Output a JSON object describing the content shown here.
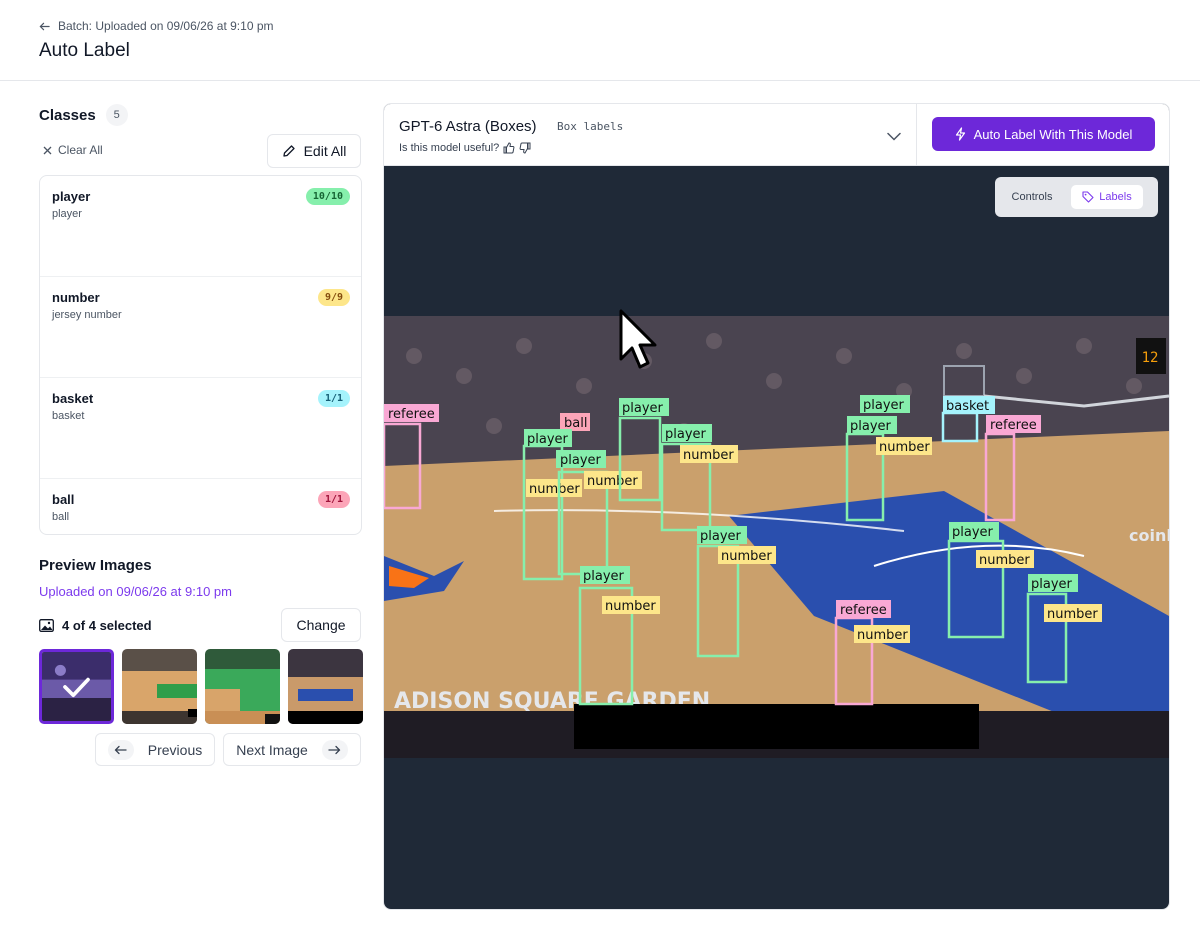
{
  "header": {
    "breadcrumb": "Batch: Uploaded on 09/06/26 at 9:10 pm",
    "title": "Auto Label"
  },
  "classes": {
    "title": "Classes",
    "count": "5",
    "clear_all": "Clear All",
    "edit_all": "Edit All",
    "items": [
      {
        "name": "player",
        "desc": "player",
        "count": "10/10",
        "color": "#86efac"
      },
      {
        "name": "number",
        "desc": "jersey number",
        "count": "9/9",
        "color": "#fde68a"
      },
      {
        "name": "basket",
        "desc": "basket",
        "count": "1/1",
        "color": "#a5f3fc"
      },
      {
        "name": "ball",
        "desc": "ball",
        "count": "1/1",
        "color": "#fca5b8"
      }
    ]
  },
  "preview": {
    "title": "Preview Images",
    "subtitle": "Uploaded on 09/06/26 at 9:10 pm",
    "selected": "4 of 4 selected",
    "change": "Change",
    "previous": "Previous",
    "next": "Next Image"
  },
  "model": {
    "name": "GPT-6 Astra (Boxes)",
    "type": "Box labels",
    "useful_prompt": "Is this model useful?",
    "auto_label_button": "Auto Label With This Model"
  },
  "view_toggle": {
    "controls": "Controls",
    "labels": "Labels"
  },
  "annotations": {
    "player": "player",
    "number": "number",
    "basket": "basket",
    "ball": "ball",
    "referee": "referee",
    "arena_text": "ADISON SQUARE GARDEN",
    "sponsor": "coinb"
  },
  "colors": {
    "accent": "#6d28d9",
    "player": "#86efac",
    "number": "#fde68a",
    "basket": "#a5f3fc",
    "ball": "#fca5b8",
    "referee": "#f9a8d4"
  }
}
